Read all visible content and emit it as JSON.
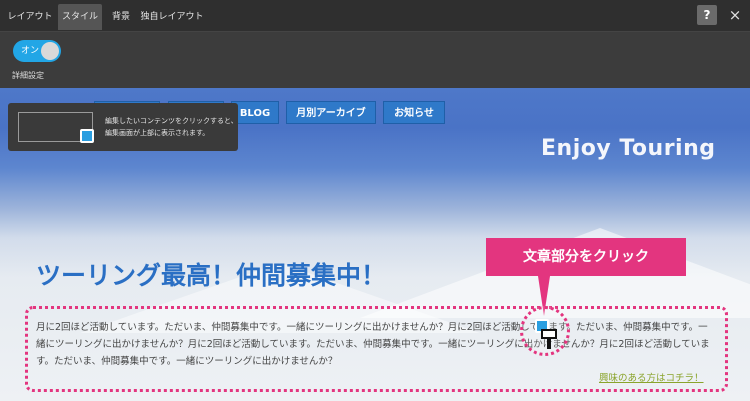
{
  "toolbar": {
    "tabs": [
      {
        "label": "レイアウト"
      },
      {
        "label": "スタイル"
      },
      {
        "label": "背景"
      },
      {
        "label": "独自レイアウト"
      }
    ],
    "help_label": "?",
    "close_label": "×"
  },
  "subpanel": {
    "toggle_label": "オン",
    "setting_label": "詳細設定"
  },
  "site": {
    "nav": [
      "BLOG",
      "月別アーカイブ",
      "お知らせ"
    ],
    "title": "Enjoy Touring"
  },
  "tooltip": {
    "line1": "編集したいコンテンツをクリックすると、",
    "line2": "編集画面が上部に表示されます。"
  },
  "content": {
    "heading": "ツーリング最高！仲間募集中！",
    "body": "月に2回ほど活動しています。ただいま、仲間募集中です。一緒にツーリングに出かけませんか？月に2回ほど活動しています。ただいま、仲間募集中です。一緒にツーリングに出かけませんか？月に2回ほど活動しています。ただいま、仲間募集中です。一緒にツーリングに出かけませんか？月に2回ほど活動しています。ただいま、仲間募集中です。一緒にツーリングに出かけませんか？",
    "link": "興味のある方はコチラ！"
  },
  "callout": {
    "label": "文章部分をクリック"
  },
  "colors": {
    "accent": "#22a6e6",
    "callout": "#e3357f",
    "heading": "#2a6fc4",
    "nav": "#2f79c9"
  }
}
